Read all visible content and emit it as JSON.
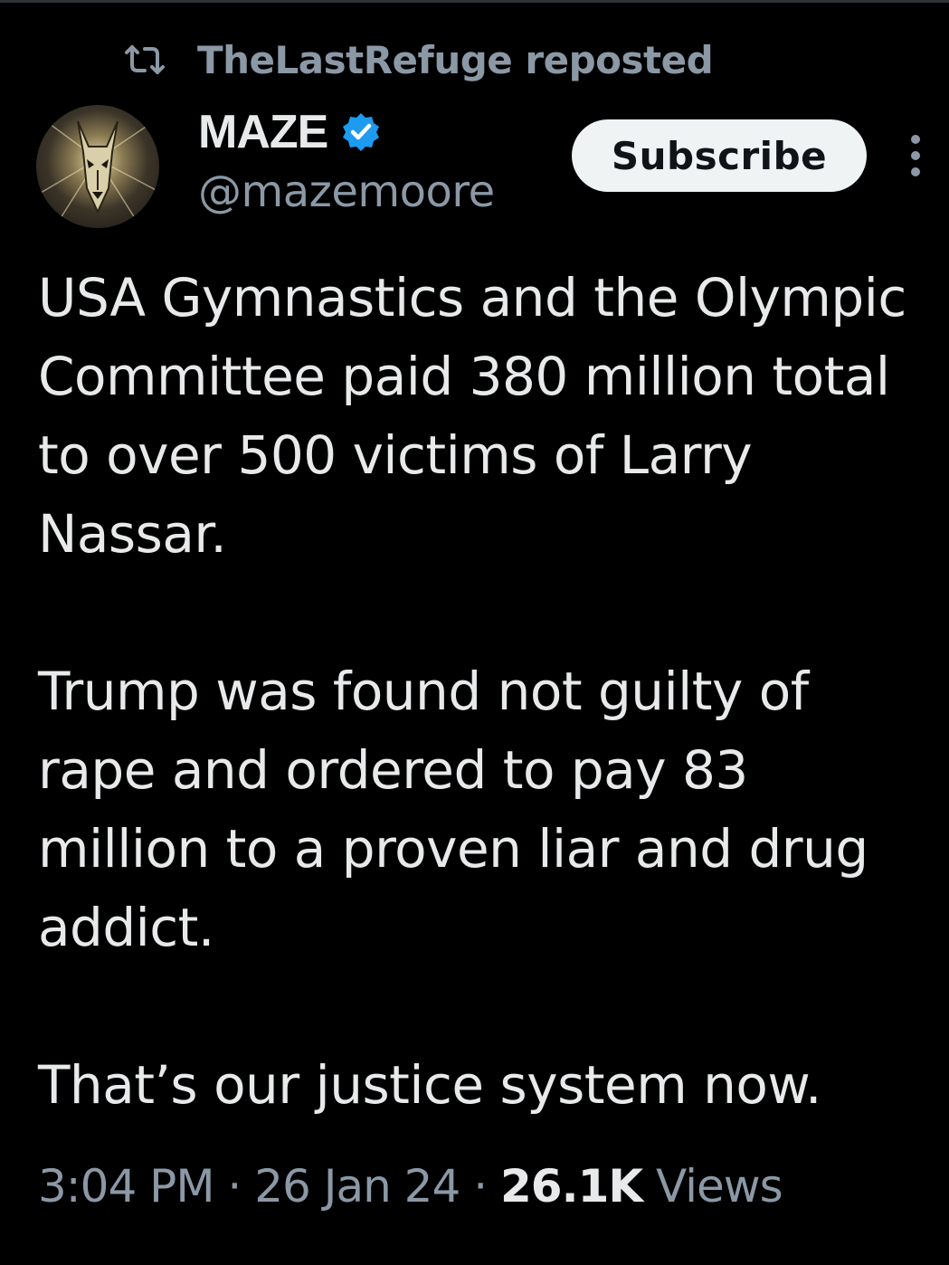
{
  "repost": {
    "text": "TheLastRefuge reposted",
    "icon": "repost-icon"
  },
  "author": {
    "display_name": "MAZE",
    "handle": "@mazemoore",
    "verified": true,
    "verified_color": "#1d9bf0"
  },
  "header": {
    "subscribe_label": "Subscribe",
    "more_icon": "more-vertical-icon"
  },
  "tweet": {
    "paragraphs": [
      "USA Gymnastics and the Olympic Committee paid 380 million total to over 500 victims of Larry Nassar.",
      "Trump was found not guilty of rape and ordered to pay 83 million to a proven liar and drug addict.",
      "That’s our justice system now."
    ]
  },
  "meta": {
    "time": "3:04 PM",
    "separator": "·",
    "date": "26 Jan 24",
    "views_count": "26.1K",
    "views_label": "Views"
  },
  "colors": {
    "background": "#000000",
    "text_primary": "#e7e9ea",
    "text_secondary": "#8b98a5",
    "accent": "#1d9bf0"
  }
}
